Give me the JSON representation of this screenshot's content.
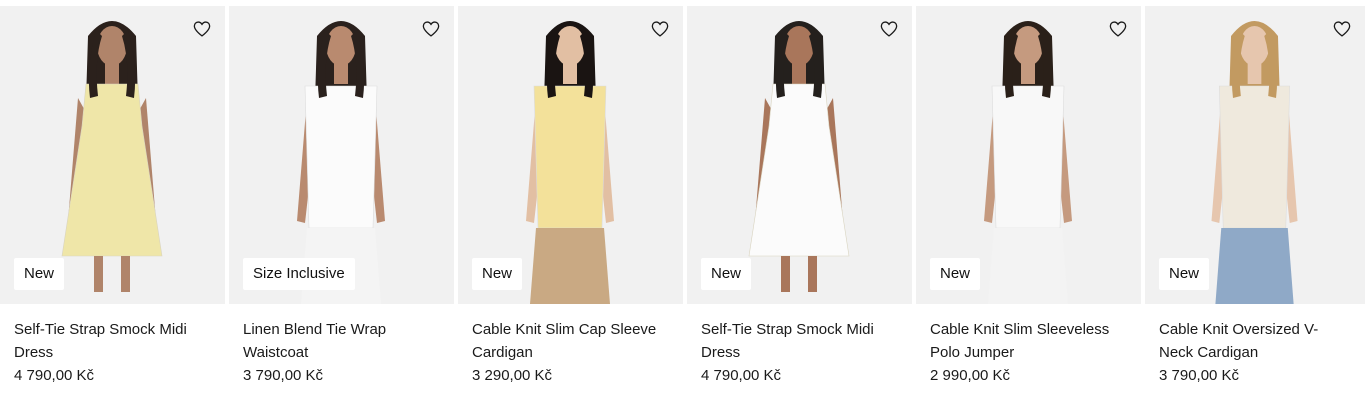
{
  "products": [
    {
      "badge": "New",
      "name": "Self-Tie Strap Smock Midi Dress",
      "price": "4 790,00 Kč",
      "colors": {
        "top": "#efe6a8",
        "bottom": "#efe6a8",
        "skin": "#b0846a",
        "hair": "#2b211c"
      }
    },
    {
      "badge": "Size Inclusive",
      "name": "Linen Blend Tie Wrap Waistcoat",
      "price": "3 790,00 Kč",
      "colors": {
        "top": "#fbfbfb",
        "bottom": "#f4f4f4",
        "skin": "#b98a6f",
        "hair": "#2a211d"
      }
    },
    {
      "badge": "New",
      "name": "Cable Knit Slim Cap Sleeve Cardigan",
      "price": "3 290,00 Kč",
      "colors": {
        "top": "#f3e19a",
        "bottom": "#c9a983",
        "skin": "#e2bfa3",
        "hair": "#1a1412"
      }
    },
    {
      "badge": "New",
      "name": "Self-Tie Strap Smock Midi Dress",
      "price": "4 790,00 Kč",
      "colors": {
        "top": "#fbfbfb",
        "bottom": "#fbfbfb",
        "skin": "#a9765b",
        "hair": "#24201d"
      }
    },
    {
      "badge": "New",
      "name": "Cable Knit Slim Sleeveless Polo Jumper",
      "price": "2 990,00 Kč",
      "colors": {
        "top": "#f8f8f8",
        "bottom": "#f3f3f3",
        "skin": "#c59a7f",
        "hair": "#2a2019"
      }
    },
    {
      "badge": "New",
      "name": "Cable Knit Oversized V-Neck Cardigan",
      "price": "3 790,00 Kč",
      "colors": {
        "top": "#efe9dd",
        "bottom": "#8fa9c7",
        "skin": "#e6c6ae",
        "hair": "#c29a61"
      }
    }
  ]
}
